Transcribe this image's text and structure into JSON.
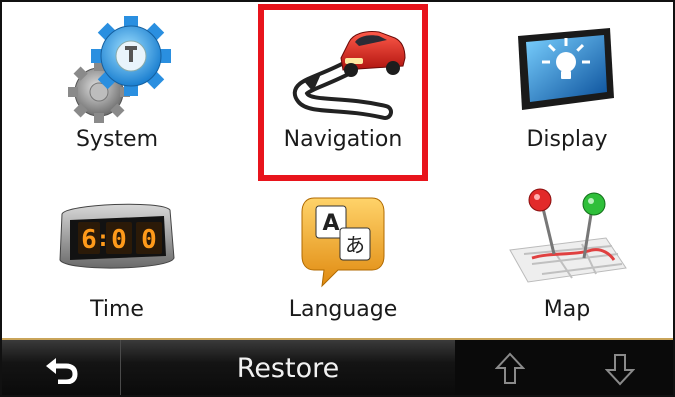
{
  "menu": {
    "items": [
      {
        "label": "System",
        "icon": "gears-icon"
      },
      {
        "label": "Navigation",
        "icon": "car-route-icon",
        "highlighted": true
      },
      {
        "label": "Display",
        "icon": "display-bulb-icon"
      },
      {
        "label": "Time",
        "icon": "alarm-clock-icon",
        "clock_text": "6:00"
      },
      {
        "label": "Language",
        "icon": "language-bubble-icon",
        "glyph_a": "A",
        "glyph_b": "あ"
      },
      {
        "label": "Map",
        "icon": "map-pins-icon"
      }
    ]
  },
  "bottom_bar": {
    "back_icon": "back-arrow-icon",
    "restore_label": "Restore",
    "up_icon": "arrow-up-icon",
    "down_icon": "arrow-down-icon"
  },
  "colors": {
    "highlight": "#e8141c",
    "bar_accent": "#c9a45a",
    "clock_digits": "#ff9a1a"
  }
}
